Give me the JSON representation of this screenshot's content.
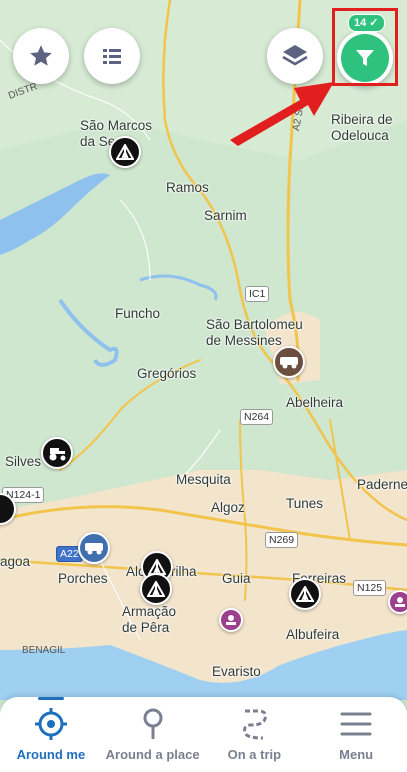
{
  "map": {
    "places": [
      {
        "id": "sao-marcos",
        "text": "São Marcos\nda Serra"
      },
      {
        "id": "ramos",
        "text": "Ramos"
      },
      {
        "id": "sarnim",
        "text": "Sarnim"
      },
      {
        "id": "ribeira",
        "text": "Ribeira de\nOdelouca"
      },
      {
        "id": "funcho",
        "text": "Funcho"
      },
      {
        "id": "sao-bartolomeu",
        "text": "São Bartolomeu\nde Messines"
      },
      {
        "id": "gregorios",
        "text": "Gregórios"
      },
      {
        "id": "abelheira",
        "text": "Abelheira"
      },
      {
        "id": "silves",
        "text": "Silves"
      },
      {
        "id": "mesquita",
        "text": "Mesquita"
      },
      {
        "id": "paderne",
        "text": "Paderne"
      },
      {
        "id": "algoz",
        "text": "Algoz"
      },
      {
        "id": "tunes",
        "text": "Tunes"
      },
      {
        "id": "lagoa",
        "text": "agoa"
      },
      {
        "id": "porches",
        "text": "Porches"
      },
      {
        "id": "alcantarilha",
        "text": "Alcantarilha"
      },
      {
        "id": "guia",
        "text": "Guia"
      },
      {
        "id": "ferreiras",
        "text": "Ferreiras"
      },
      {
        "id": "armacao",
        "text": "Armação\nde Pêra"
      },
      {
        "id": "albufeira",
        "text": "Albufeira"
      },
      {
        "id": "evaristo",
        "text": "Evaristo"
      },
      {
        "id": "benagil",
        "text": "BENAGIL"
      }
    ],
    "roads": {
      "ic1": "IC1",
      "n264": "N264",
      "n269": "N269",
      "n125": "N125",
      "n124": "N124-1",
      "a22": "A22",
      "a2": "A2 Su",
      "distr": "DISTR"
    },
    "marker_icons": [
      "tent-icon",
      "tractor-icon",
      "campervan-icon",
      "tent-icon",
      "tent-icon",
      "tent-icon",
      "campervan-icon",
      "service-icon",
      "service-icon"
    ]
  },
  "filter": {
    "badge": "14 ✓"
  },
  "tabs": [
    {
      "label": "Around me",
      "icon": "target-icon",
      "active": true
    },
    {
      "label": "Around a place",
      "icon": "pin-search-icon",
      "active": false
    },
    {
      "label": "On a trip",
      "icon": "route-icon",
      "active": false
    },
    {
      "label": "Menu",
      "icon": "menu-icon",
      "active": false
    }
  ],
  "colors": {
    "accent": "#2ec27e",
    "active_tab": "#1f6fbd",
    "highlight": "#e21f1f",
    "arrow": "#e21f1f"
  }
}
